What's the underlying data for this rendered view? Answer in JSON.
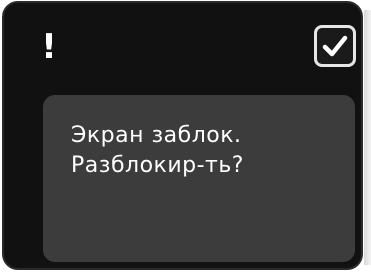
{
  "header": {
    "alert_symbol": "!",
    "confirm_icon": "checkmark-icon"
  },
  "dialog": {
    "line1": "Экран заблок.",
    "line2": "Разблокир-ть?"
  },
  "colors": {
    "screen_background": "#111111",
    "panel_background": "#3c3c3c",
    "text": "#ffffff",
    "button_border": "#e6e6e6"
  }
}
